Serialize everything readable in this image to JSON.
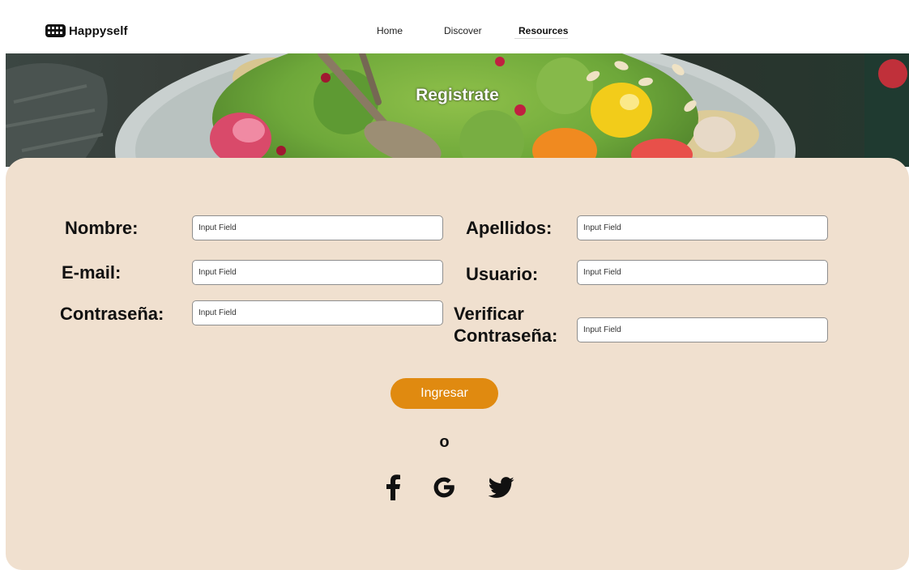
{
  "app": {
    "brand_name": "Happyself",
    "brand_icon": "keyboard-logo-icon"
  },
  "nav": {
    "items": [
      {
        "label": "Home"
      },
      {
        "label": "Discover"
      },
      {
        "label": "Resources",
        "active": true
      }
    ]
  },
  "hero": {
    "title": "Registrate",
    "image": "salad-bowl-photo"
  },
  "form": {
    "nombre": {
      "label": "Nombre:",
      "placeholder": "Input Field"
    },
    "apellidos": {
      "label": "Apellidos:",
      "placeholder": "Input Field"
    },
    "email": {
      "label": "E-mail:",
      "placeholder": "Input Field"
    },
    "usuario": {
      "label": "Usuario:",
      "placeholder": "Input Field"
    },
    "contrasena": {
      "label": "Contraseña:",
      "placeholder": "Input Field"
    },
    "verificar": {
      "label_line1": "Verificar",
      "label_line2": "Contraseña:",
      "placeholder": "Input Field"
    },
    "submit_label": "Ingresar",
    "or_text": "o"
  },
  "social": {
    "icons": [
      "facebook-icon",
      "google-icon",
      "twitter-icon"
    ]
  },
  "colors": {
    "card_background": "#f0e0cf",
    "button": "#e08a10",
    "text": "#111111"
  }
}
